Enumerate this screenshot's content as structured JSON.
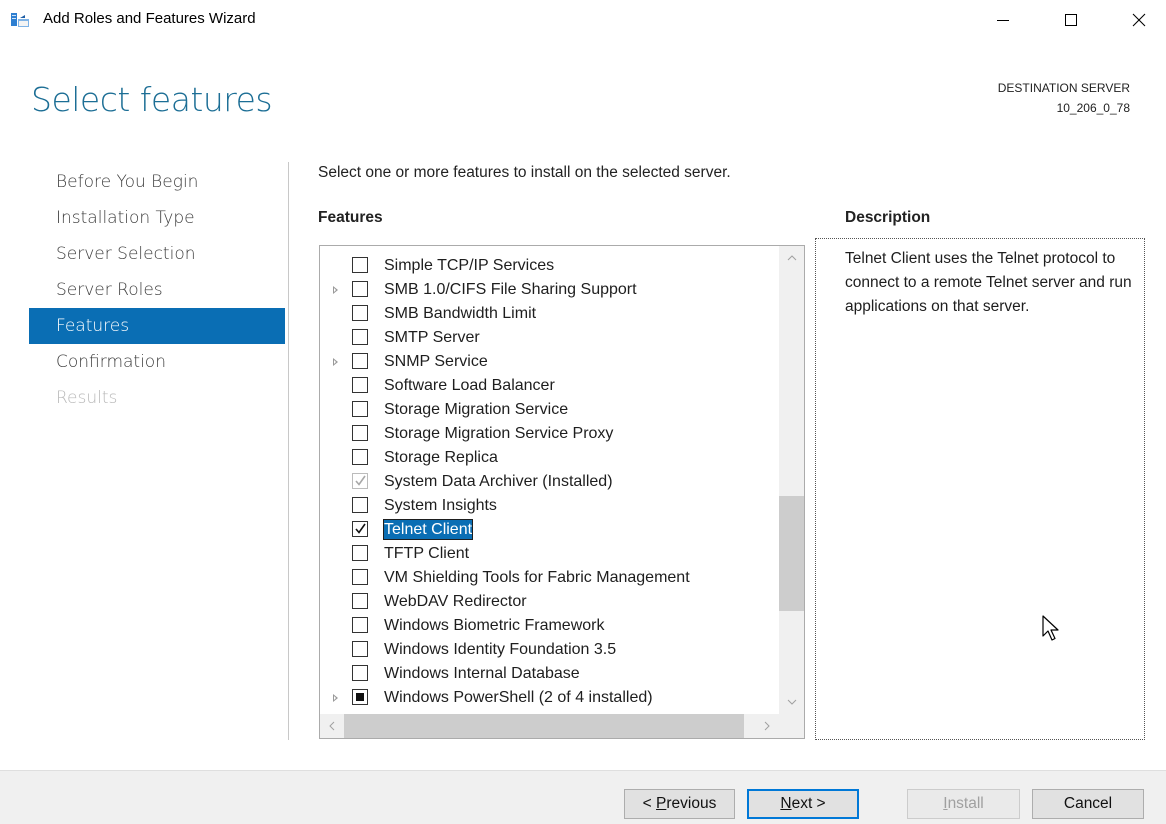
{
  "window": {
    "title": "Add Roles and Features Wizard",
    "icon": "server-manager-icon",
    "controls": [
      "minimize-icon",
      "maximize-icon",
      "close-icon"
    ]
  },
  "page": {
    "title": "Select features",
    "destination_label": "DESTINATION SERVER",
    "destination_value": "10_206_0_78"
  },
  "nav": {
    "items": [
      {
        "label": "Before You Begin",
        "state": "normal"
      },
      {
        "label": "Installation Type",
        "state": "normal"
      },
      {
        "label": "Server Selection",
        "state": "normal"
      },
      {
        "label": "Server Roles",
        "state": "normal"
      },
      {
        "label": "Features",
        "state": "selected"
      },
      {
        "label": "Confirmation",
        "state": "normal"
      },
      {
        "label": "Results",
        "state": "disabled"
      }
    ]
  },
  "main": {
    "instruction": "Select one or more features to install on the selected server.",
    "features_heading": "Features",
    "description_heading": "Description",
    "description_text": "Telnet Client uses the Telnet protocol to connect to a remote Telnet server and run applications on that server.",
    "features": [
      {
        "label": "Simple TCP/IP Services",
        "expandable": false,
        "state": "unchecked",
        "selected": false
      },
      {
        "label": "SMB 1.0/CIFS File Sharing Support",
        "expandable": true,
        "state": "unchecked",
        "selected": false
      },
      {
        "label": "SMB Bandwidth Limit",
        "expandable": false,
        "state": "unchecked",
        "selected": false
      },
      {
        "label": "SMTP Server",
        "expandable": false,
        "state": "unchecked",
        "selected": false
      },
      {
        "label": "SNMP Service",
        "expandable": true,
        "state": "unchecked",
        "selected": false
      },
      {
        "label": "Software Load Balancer",
        "expandable": false,
        "state": "unchecked",
        "selected": false
      },
      {
        "label": "Storage Migration Service",
        "expandable": false,
        "state": "unchecked",
        "selected": false
      },
      {
        "label": "Storage Migration Service Proxy",
        "expandable": false,
        "state": "unchecked",
        "selected": false
      },
      {
        "label": "Storage Replica",
        "expandable": false,
        "state": "unchecked",
        "selected": false
      },
      {
        "label": "System Data Archiver (Installed)",
        "expandable": false,
        "state": "installed",
        "selected": false
      },
      {
        "label": "System Insights",
        "expandable": false,
        "state": "unchecked",
        "selected": false
      },
      {
        "label": "Telnet Client",
        "expandable": false,
        "state": "checked",
        "selected": true
      },
      {
        "label": "TFTP Client",
        "expandable": false,
        "state": "unchecked",
        "selected": false
      },
      {
        "label": "VM Shielding Tools for Fabric Management",
        "expandable": false,
        "state": "unchecked",
        "selected": false
      },
      {
        "label": "WebDAV Redirector",
        "expandable": false,
        "state": "unchecked",
        "selected": false
      },
      {
        "label": "Windows Biometric Framework",
        "expandable": false,
        "state": "unchecked",
        "selected": false
      },
      {
        "label": "Windows Identity Foundation 3.5",
        "expandable": false,
        "state": "unchecked",
        "selected": false
      },
      {
        "label": "Windows Internal Database",
        "expandable": false,
        "state": "unchecked",
        "selected": false
      },
      {
        "label": "Windows PowerShell (2 of 4 installed)",
        "expandable": true,
        "state": "partial",
        "selected": false
      }
    ]
  },
  "footer": {
    "previous": {
      "prefix": "< ",
      "mnemonic": "P",
      "rest": "revious"
    },
    "next": {
      "mnemonic": "N",
      "rest": "ext >"
    },
    "install": {
      "mnemonic": "I",
      "rest": "nstall"
    },
    "cancel": "Cancel"
  },
  "colors": {
    "accent": "#0a6eb4",
    "title": "#1c6e95",
    "footer_bg": "#f0f0f0"
  }
}
